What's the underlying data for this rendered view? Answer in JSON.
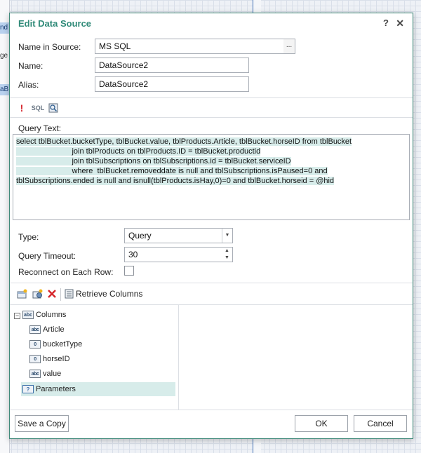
{
  "background": {
    "frag1": "nd",
    "frag2": "ge",
    "frag3": "aB"
  },
  "dialog": {
    "title": "Edit Data Source",
    "help_label": "?",
    "close_label": "✕"
  },
  "form": {
    "name_in_source_label": "Name in Source:",
    "name_in_source_value": "MS SQL",
    "ellipsis_label": "...",
    "name_label": "Name:",
    "name_value": "DataSource2",
    "alias_label": "Alias:",
    "alias_value": "DataSource2"
  },
  "toolbar": {
    "exclamation_glyph": "!",
    "sql_label": "SQL"
  },
  "query": {
    "label": "Query Text:",
    "lines": [
      "select tblBucket.bucketType, tblBucket.value, tblProducts.Article, tblBucket.horseID from tblBucket",
      "                          join tblProducts on tblProducts.ID = tblBucket.productid",
      "                          join tblSubscriptions on tblSubscriptions.id = tblBucket.serviceID",
      "                          where  tblBucket.removeddate is null and tblSubscriptions.isPaused=0 and",
      "tblSubscriptions.ended is null and isnull(tblProducts.isHay,0)=0 and tblBucket.horseid = @hid"
    ]
  },
  "settings": {
    "type_label": "Type:",
    "type_value": "Query",
    "timeout_label": "Query Timeout:",
    "timeout_value": "30",
    "reconnect_label": "Reconnect on Each Row:",
    "reconnect_checked": false
  },
  "columns_toolbar": {
    "retrieve_label": "Retrieve Columns"
  },
  "tree": {
    "columns_label": "Columns",
    "columns_badge": "abc",
    "items": [
      {
        "label": "Article",
        "badge": "abc"
      },
      {
        "label": "bucketType",
        "badge": "0"
      },
      {
        "label": "horseID",
        "badge": "0"
      },
      {
        "label": "value",
        "badge": "abc"
      }
    ],
    "parameters_label": "Parameters",
    "parameters_badge": "?"
  },
  "footer": {
    "save_copy_label": "Save a Copy",
    "ok_label": "OK",
    "cancel_label": "Cancel"
  },
  "colors": {
    "accent": "#2f8a78",
    "selection": "#d7ecea",
    "border": "#3f8a7a"
  }
}
